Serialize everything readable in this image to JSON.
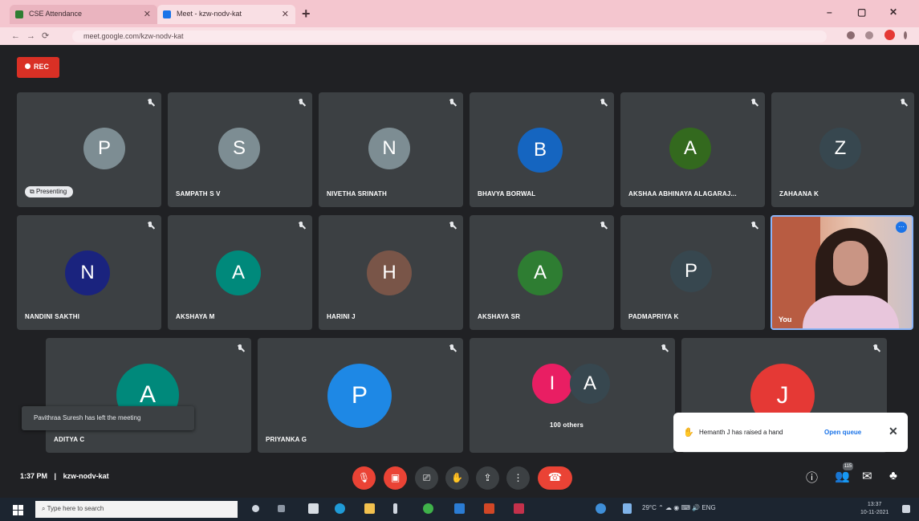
{
  "browser": {
    "tabs": [
      {
        "title": "CSE Attendance"
      },
      {
        "title": "Meet - kzw-nodv-kat"
      }
    ],
    "new_tab_label": "+",
    "url": "meet.google.com/kzw-nodv-kat",
    "window_controls": {
      "minimize": "–",
      "restore": "▢",
      "close": "✕"
    }
  },
  "meet": {
    "recording_label": "REC",
    "presenting_label": "Presenting",
    "tiles": [
      {
        "initial": "P",
        "name": "",
        "color": "#7d8d93",
        "presenting": true
      },
      {
        "initial": "S",
        "name": "SAMPATH S V",
        "color": "#7d8d93"
      },
      {
        "initial": "N",
        "name": "NIVETHA SRINATH",
        "color": "#7d8d93"
      },
      {
        "initial": "B",
        "name": "BHAVYA BORWAL",
        "color": "#1565c0"
      },
      {
        "initial": "A",
        "name": "AKSHAA ABHINAYA ALAGARAJ...",
        "color": "#33691e"
      },
      {
        "initial": "Z",
        "name": "ZAHAANA K",
        "color": "#37474f"
      },
      {
        "initial": "N",
        "name": "NANDINI SAKTHI",
        "color": "#1a237e"
      },
      {
        "initial": "A",
        "name": "AKSHAYA M",
        "color": "#00897b"
      },
      {
        "initial": "H",
        "name": "HARINI J",
        "color": "#795548"
      },
      {
        "initial": "A",
        "name": "AKSHAYA SR",
        "color": "#2e7d32"
      },
      {
        "initial": "P",
        "name": "PADMAPRIYA K",
        "color": "#37474f"
      },
      {
        "initial": "A",
        "name": "ADITYA C",
        "color": "#00897b"
      },
      {
        "initial": "P",
        "name": "PRIYANKA G",
        "color": "#1e88e5"
      },
      {
        "initial": "",
        "name": "100 others",
        "color": ""
      },
      {
        "initial": "J",
        "name": "",
        "color": "#e53935"
      }
    ],
    "others_initials": [
      {
        "initial": "I",
        "color": "#e91e63"
      },
      {
        "initial": "A",
        "color": "#37474f"
      }
    ],
    "self_view": {
      "name": "You"
    },
    "toast": "Pavithraa Suresh has left the meeting",
    "hand_popup": {
      "text": "Hemanth J has raised a hand",
      "action": "Open queue",
      "close": "✕"
    },
    "bottom": {
      "time": "1:37 PM",
      "separator": "|",
      "meeting_code": "kzw-nodv-kat",
      "people_count": "115"
    }
  },
  "taskbar": {
    "search_placeholder": "Type here to search",
    "weather": "29°C",
    "time": "13:37",
    "date": "10-11-2021"
  },
  "colors": {
    "accent": "#1a73e8",
    "danger": "#ea4335",
    "tile": "#3c4043",
    "background": "#202124"
  }
}
